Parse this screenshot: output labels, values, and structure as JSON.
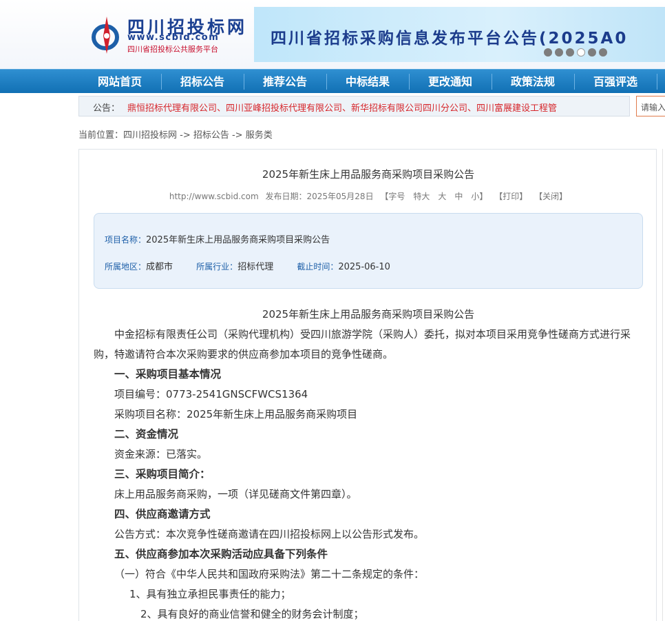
{
  "logo": {
    "title": "四川招投标网",
    "url": "www.scbid.com",
    "subtitle": "四川省招投标公共服务平台"
  },
  "banner": {
    "text": "四川省招标采购信息发布平台公告(2025A0",
    "dots": 6,
    "active_dot": 3
  },
  "nav": {
    "items": [
      "网站首页",
      "招标公告",
      "推荐公告",
      "中标结果",
      "更改通知",
      "政策法规",
      "百强评选"
    ]
  },
  "notice": {
    "label": "公告：",
    "text": "鼎恒招标代理有限公司、四川亚峰招投标代理有限公司、新华招标有限公司四川分公司、四川富展建设工程管"
  },
  "search": {
    "placeholder": "请输入"
  },
  "breadcrumb": "当前位置：四川招投标网 -> 招标公告 -> 服务类",
  "article": {
    "title": "2025年新生床上用品服务商采购项目采购公告",
    "meta": {
      "site": "http://www.scbid.com",
      "date": "发布日期：2025年05月28日",
      "font_size": "【字号　特大　大　中　小】",
      "print": "【打印】",
      "close": "【关闭】"
    },
    "info": {
      "project_key": "项目名称：",
      "project_val": "2025年新生床上用品服务商采购项目采购公告",
      "region_key": "所属地区：",
      "region_val": "成都市",
      "industry_key": "所属行业：",
      "industry_val": "招标代理",
      "deadline_key": "截止时间：",
      "deadline_val": "2025-06-10"
    },
    "paragraphs": [
      "2025年新生床上用品服务商采购项目采购公告",
      "中金招标有限责任公司（采购代理机构）受四川旅游学院（采购人）委托，拟对本项目采用竞争性磋商方式进行采购，特邀请符合本次采购要求的供应商参加本项目的竞争性磋商。",
      "一、采购项目基本情况",
      "项目编号：0773-2541GNSCFWCS1364",
      "采购项目名称：2025年新生床上用品服务商采购项目",
      "二、资金情况",
      "资金来源：已落实。",
      "三、采购项目简介：",
      "床上用品服务商采购，一项（详见磋商文件第四章）。",
      "四、供应商邀请方式",
      "公告方式：本次竞争性磋商邀请在四川招投标网上以公告形式发布。",
      "五、供应商参加本次采购活动应具备下列条件",
      "（一）符合《中华人民共和国政府采购法》第二十二条规定的条件：",
      "1、具有独立承担民事责任的能力；",
      "2、具有良好的商业信誉和健全的财务会计制度；"
    ]
  }
}
